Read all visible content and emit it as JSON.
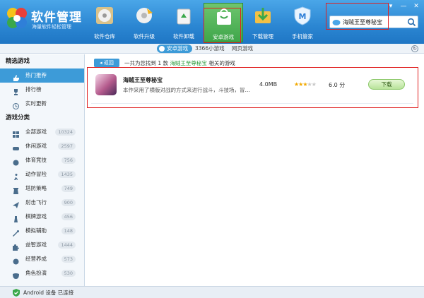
{
  "app": {
    "title": "软件管理",
    "subtitle": "海量软件轻松管理"
  },
  "window_controls": [
    "▾",
    "—",
    "✕"
  ],
  "nav": [
    {
      "label": "软件仓库",
      "icon": "disc-icon"
    },
    {
      "label": "软件升级",
      "icon": "upgrade-icon"
    },
    {
      "label": "软件卸载",
      "icon": "recycle-bin-icon"
    },
    {
      "label": "安卓游戏",
      "icon": "android-bag-icon",
      "active": true
    },
    {
      "label": "下载管理",
      "icon": "download-folder-icon"
    },
    {
      "label": "手机管家",
      "icon": "phone-manager-icon"
    }
  ],
  "search": {
    "value": "海贼王至尊秘宝",
    "icon": "search-icon"
  },
  "subtabs": {
    "android_games": "安卓游戏",
    "mini_games": "3366小游戏",
    "web_games": "网页游戏"
  },
  "sidebar": {
    "featured_title": "精选游戏",
    "featured": [
      {
        "label": "热门推荐",
        "icon": "thumb-up-icon",
        "active": true
      },
      {
        "label": "排行榜",
        "icon": "trophy-icon"
      },
      {
        "label": "实时更新",
        "icon": "clock-icon"
      }
    ],
    "categories_title": "游戏分类",
    "categories": [
      {
        "label": "全部游戏",
        "count": "10324",
        "icon": "grid-icon"
      },
      {
        "label": "休闲游戏",
        "count": "2597",
        "icon": "controller-icon"
      },
      {
        "label": "体育竞技",
        "count": "756",
        "icon": "ball-icon"
      },
      {
        "label": "动作冒险",
        "count": "1435",
        "icon": "runner-icon"
      },
      {
        "label": "塔防策略",
        "count": "749",
        "icon": "tower-icon"
      },
      {
        "label": "射击飞行",
        "count": "900",
        "icon": "plane-icon"
      },
      {
        "label": "棋牌游戏",
        "count": "456",
        "icon": "chess-icon"
      },
      {
        "label": "模拟辅助",
        "count": "148",
        "icon": "wand-icon"
      },
      {
        "label": "益智游戏",
        "count": "1444",
        "icon": "puzzle-icon"
      },
      {
        "label": "经营养成",
        "count": "573",
        "icon": "coin-icon"
      },
      {
        "label": "角色扮演",
        "count": "530",
        "icon": "mask-icon"
      }
    ]
  },
  "main": {
    "back_label": "◂ 返回",
    "result_prefix": "一共为您找到 1 款",
    "result_keyword": "海贼王至尊秘宝",
    "result_suffix": "相关的游戏",
    "results": [
      {
        "name": "海贼王至尊秘宝",
        "desc": "本作采用了横版对战的方式来进行战斗，斗技场，冒…",
        "size": "4.0MB",
        "rating": 3,
        "rating_max": 5,
        "score": "6.0 分",
        "download_label": "下载"
      }
    ]
  },
  "status": {
    "text": "Android 设备 已连接",
    "color": "#2a9a3a"
  },
  "colors": {
    "header": "#2b86d2",
    "accent": "#3d9bd8",
    "highlight": "#e02020"
  }
}
